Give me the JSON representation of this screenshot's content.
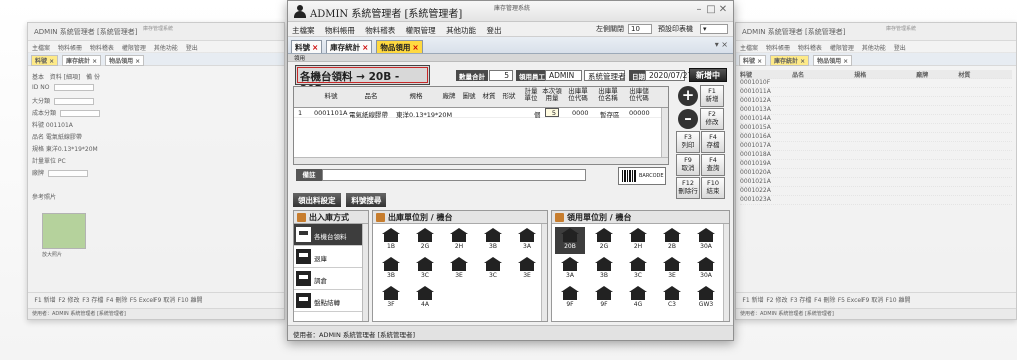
{
  "left_window": {
    "title": "ADMIN 系統管理者 [系統管理者]",
    "sysname": "庫存管理系統",
    "menu": [
      "主檔案",
      "物料帳冊",
      "物料稽表",
      "權限管理",
      "其他功能",
      "登出"
    ],
    "tabs": [
      "料號 ×",
      "庫存統計 ×",
      "物品領用 ×"
    ],
    "subtabs": [
      "基本",
      "資料 [細項]",
      "備 份"
    ],
    "fields": [
      "ID NO",
      "大分類",
      "成本分類",
      "料號 001101A",
      "品名 電氣紙線膠帶",
      "規格 東洋0.13*19*20M",
      "計量單位 PC",
      "廠牌"
    ],
    "photo_label": "參考照片",
    "photo_note": "放大照片",
    "footer": [
      "F1 新增",
      "F2 修改",
      "F3 存檔",
      "F4 刪除",
      "F5 Excel",
      "F9 取消",
      "F10 離開"
    ],
    "status": "使用者：ADMIN 系統管理者 [系統管理者]"
  },
  "right_window": {
    "title": "ADMIN 系統管理者 [系統管理者]",
    "sysname": "庫存管理系統",
    "menu": [
      "主檔案",
      "物料帳冊",
      "物料稽表",
      "權限管理",
      "其他功能",
      "登出"
    ],
    "tabs": [
      "料號 ×",
      "庫存統計 ×",
      "物品領用 ×"
    ],
    "columns": [
      "料號",
      "品名",
      "規格",
      "廠牌",
      "材質"
    ],
    "rows": [
      "0001010F",
      "0001011A",
      "0001012A",
      "0001013A",
      "0001014A",
      "0001015A",
      "0001016A",
      "0001017A",
      "0001018A",
      "0001019A",
      "0001020A",
      "0001021A",
      "0001022A",
      "0001023A"
    ],
    "footer": [
      "F1 新增",
      "F2 修改",
      "F3 存檔",
      "F4 刪除",
      "F5 Excel",
      "F9 取消",
      "F10 離開"
    ],
    "status": "使用者：ADMIN 系統管理者 [系統管理者]"
  },
  "main": {
    "app_title": "ADMIN 系統管理者 [系統管理者]",
    "sysname": "庫存管理系統",
    "menu": [
      "主檔案",
      "物料帳冊",
      "物料稽表",
      "權限管理",
      "其他功能",
      "登出"
    ],
    "printer_label": "左側關閉",
    "printer_value": "10",
    "report_label": "預設印表機",
    "tabs": [
      {
        "label": "料號",
        "active": false
      },
      {
        "label": "庫存統計",
        "active": false
      },
      {
        "label": "物品領用",
        "active": true
      }
    ],
    "subbar": "領用",
    "banner": "各機台領料 → 20B - 20B",
    "qty_total_label": "數量合計",
    "qty_total_value": "5",
    "staff_label": "領用員工",
    "staff_id": "ADMIN",
    "staff_name": "系統管理者",
    "date_label": "日期",
    "date_value": "2020/07/27",
    "new_button": "新增中",
    "grid_columns": [
      "料號",
      "品名",
      "規格",
      "廠牌",
      "圖號",
      "材質",
      "形狀",
      "計量單位",
      "本次領用量",
      "出庫單位代碼",
      "出庫單位名稱",
      "出庫儲位代碼"
    ],
    "grid_rows": [
      {
        "no": "1",
        "part": "0001101A",
        "name": "電氣紙線膠帶",
        "spec": "東洋0.13*19*20M",
        "unit": "個",
        "qty": "5",
        "out_code": "0000",
        "out_name": "暫存區",
        "loc_code": "00000"
      }
    ],
    "side_buttons": [
      {
        "key": "F1",
        "label": "新增"
      },
      {
        "key": "F2",
        "label": "修改"
      },
      {
        "key": "F3",
        "label": "列印"
      },
      {
        "key": "F4",
        "label": "存檔"
      },
      {
        "key": "F9",
        "label": "取消"
      },
      {
        "key": "F4",
        "label": "查詢"
      },
      {
        "key": "F12",
        "label": "刪除行"
      },
      {
        "key": "F10",
        "label": "結束"
      }
    ],
    "remark_label": "備註",
    "barcode_text": "BARCODE",
    "mid_buttons": [
      "領出料設定",
      "料號搜尋"
    ],
    "panel_in_out": {
      "title": "出入庫方式",
      "items": [
        "各機台領料",
        "退庫",
        "調倉",
        "盤點結轉"
      ]
    },
    "panel_out_unit": {
      "title": "出庫單位別 / 機台",
      "cells": [
        "1B",
        "2G",
        "2H",
        "3B",
        "3A",
        "3B",
        "3C",
        "3E",
        "3C",
        "3E",
        "3F",
        "4A"
      ]
    },
    "panel_in_unit": {
      "title": "領用單位別 / 機台",
      "cells": [
        "20B",
        "2G",
        "2H",
        "2B",
        "30A",
        "3A",
        "3B",
        "3C",
        "3E",
        "30A",
        "9F",
        "9F",
        "4G",
        "C3",
        "GW3"
      ]
    },
    "status": "使用者：ADMIN 系統管理者 [系統管理者]"
  }
}
